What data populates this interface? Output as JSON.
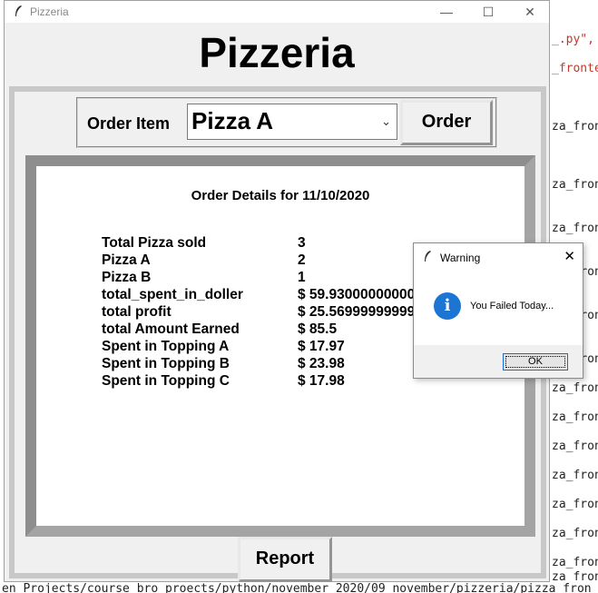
{
  "window": {
    "title": "Pizzeria",
    "minimize_icon": "minimize-icon",
    "maximize_icon": "maximize-icon",
    "close_icon": "close-icon"
  },
  "header": {
    "title": "Pizzeria"
  },
  "order": {
    "label": "Order Item",
    "selected": "Pizza A",
    "button_label": "Order"
  },
  "details": {
    "title": "Order Details for 11/10/2020",
    "rows": [
      {
        "label": "Total Pizza sold",
        "value": "3"
      },
      {
        "label": "Pizza A",
        "value": "2"
      },
      {
        "label": "Pizza B",
        "value": "1"
      },
      {
        "label": "total_spent_in_doller",
        "value": "$ 59.93000000000"
      },
      {
        "label": "total profit",
        "value": "$ 25.56999999999"
      },
      {
        "label": "total Amount Earned",
        "value": "$ 85.5"
      },
      {
        "label": "Spent in Topping A",
        "value": "$ 17.97"
      },
      {
        "label": "Spent in Topping B",
        "value": "$ 23.98"
      },
      {
        "label": "Spent in Topping C",
        "value": "$ 17.98"
      }
    ]
  },
  "report": {
    "button_label": "Report"
  },
  "dialog": {
    "title": "Warning",
    "message": "You Failed Today...",
    "ok_label": "OK",
    "icon": "info-icon",
    "icon_glyph": "i",
    "icon_color": "#1c75d3"
  },
  "background": {
    "lines": [
      {
        "text": "_.py\",",
        "red": true
      },
      {
        "text": "_fronte",
        "red": true
      },
      {
        "text": "za_fron",
        "red": false
      },
      {
        "text": "za_fron",
        "red": false
      },
      {
        "text": "za_fron",
        "red": false
      },
      {
        "text": "za_fron",
        "red": false
      },
      {
        "text": "za_fron",
        "red": false
      },
      {
        "text": "za_fron",
        "red": false
      },
      {
        "text": "za_fron",
        "red": false
      },
      {
        "text": "za_fron",
        "red": false
      },
      {
        "text": "za_fron",
        "red": false
      },
      {
        "text": "za_fron",
        "red": false
      },
      {
        "text": "za_fron",
        "red": false
      },
      {
        "text": "za_fron",
        "red": false
      },
      {
        "text": "za_fron",
        "red": false
      },
      {
        "text": "za_fron",
        "red": false
      },
      {
        "text": "za_fron",
        "red": false
      }
    ],
    "bottom_line": "en Projects/course bro proects/python/november 2020/09 november/pizzeria/pizza_fron"
  }
}
